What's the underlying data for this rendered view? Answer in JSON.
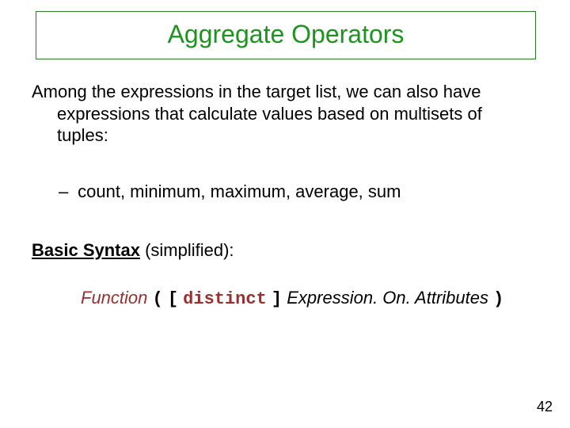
{
  "title": "Aggregate Operators",
  "intro_line1": "Among the expressions in the target list, we can also have",
  "intro_line2": "expressions that calculate values based on multisets of",
  "intro_line3": "tuples:",
  "bullet_dash": "–",
  "bullet_text": "count, minimum, maximum, average, sum",
  "basic_syntax_label": "Basic Syntax",
  "basic_syntax_suffix": " (simplified):",
  "syntax": {
    "function": "Function",
    "open_paren": "(",
    "open_bracket": "[",
    "distinct": "distinct",
    "close_bracket": "]",
    "expression": "Expression. On. Attributes",
    "close_paren": ")"
  },
  "page_number": "42"
}
